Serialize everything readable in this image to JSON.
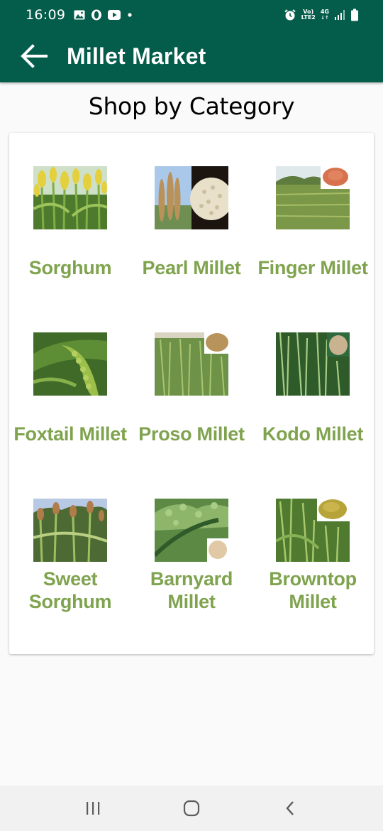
{
  "status_bar": {
    "time": "16:09",
    "left_icons": [
      "gallery-icon",
      "opera-icon",
      "youtube-icon",
      "dot-icon"
    ],
    "right_icons": [
      "alarm-icon",
      "volte-icon",
      "4g-icon",
      "signal-icon",
      "battery-icon"
    ],
    "network_top": "Vo)",
    "network_bottom": "LTE2",
    "network_type": "4G"
  },
  "app_bar": {
    "title": "Millet Market",
    "back_icon": "arrow-left-icon",
    "color": "#045d4b"
  },
  "section": {
    "title": "Shop by Category"
  },
  "categories": [
    {
      "label": "Sorghum"
    },
    {
      "label": "Pearl Millet"
    },
    {
      "label": "Finger Millet"
    },
    {
      "label": "Foxtail Millet"
    },
    {
      "label": "Proso Millet"
    },
    {
      "label": "Kodo Millet"
    },
    {
      "label_line1": "Sweet",
      "label_line2": "Sorghum"
    },
    {
      "label_line1": "Barnyard",
      "label_line2": "Millet"
    },
    {
      "label_line1": "Browntop",
      "label_line2": "Millet"
    }
  ],
  "colors": {
    "label_green": "#7fa34e",
    "card_bg": "#ffffff",
    "page_bg": "#fafafa"
  },
  "nav_bar": {
    "icons": [
      "recent-apps-icon",
      "home-icon",
      "back-chevron-icon"
    ]
  }
}
